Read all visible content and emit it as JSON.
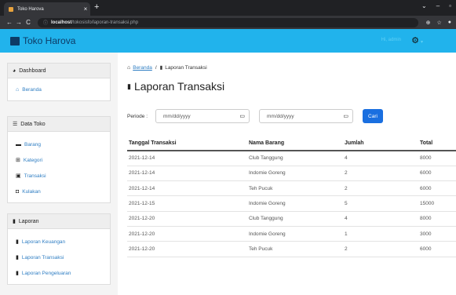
{
  "browser": {
    "tab_title": "Toko Harova",
    "url_host": "localhost",
    "url_path": "/tokosisfo/laporan-transaksi.php"
  },
  "app": {
    "brand": "Toko Harova",
    "user_greeting": "Hi, admin",
    "user_caret": "▾"
  },
  "sidebar": {
    "dashboard": {
      "title": "Dashboard",
      "items": [
        {
          "label": "Beranda"
        }
      ]
    },
    "data_toko": {
      "title": "Data Toko",
      "items": [
        {
          "label": "Barang"
        },
        {
          "label": "Kategori"
        },
        {
          "label": "Transaksi"
        },
        {
          "label": "Kulakan"
        }
      ]
    },
    "laporan": {
      "title": "Laporan",
      "items": [
        {
          "label": "Laporan Keuangan"
        },
        {
          "label": "Laporan Transaksi"
        },
        {
          "label": "Laporan Pengeluaran"
        }
      ]
    }
  },
  "breadcrumb": {
    "home": "Beranda",
    "separator": "/",
    "current": "Laporan Transaksi"
  },
  "page_title": "Laporan Transaksi",
  "filter": {
    "label": "Periode :",
    "start_placeholder": "mm/dd/yyyy",
    "end_placeholder": "mm/dd/yyyy",
    "button": "Cari"
  },
  "table": {
    "headers": [
      "Tanggal Transaksi",
      "Nama Barang",
      "Jumlah",
      "Total"
    ],
    "rows": [
      [
        "2021-12-14",
        "Club Tanggung",
        "4",
        "8000"
      ],
      [
        "2021-12-14",
        "Indomie Goreng",
        "2",
        "6000"
      ],
      [
        "2021-12-14",
        "Teh Pucuk",
        "2",
        "6000"
      ],
      [
        "2021-12-15",
        "Indomie Goreng",
        "5",
        "15000"
      ],
      [
        "2021-12-20",
        "Club Tanggung",
        "4",
        "8000"
      ],
      [
        "2021-12-20",
        "Indomie Goreng",
        "1",
        "3000"
      ],
      [
        "2021-12-20",
        "Teh Pucuk",
        "2",
        "6000"
      ]
    ]
  },
  "colors": {
    "header_bg": "#21b3ec",
    "link": "#2f7ec3",
    "button": "#1a6fe0"
  }
}
